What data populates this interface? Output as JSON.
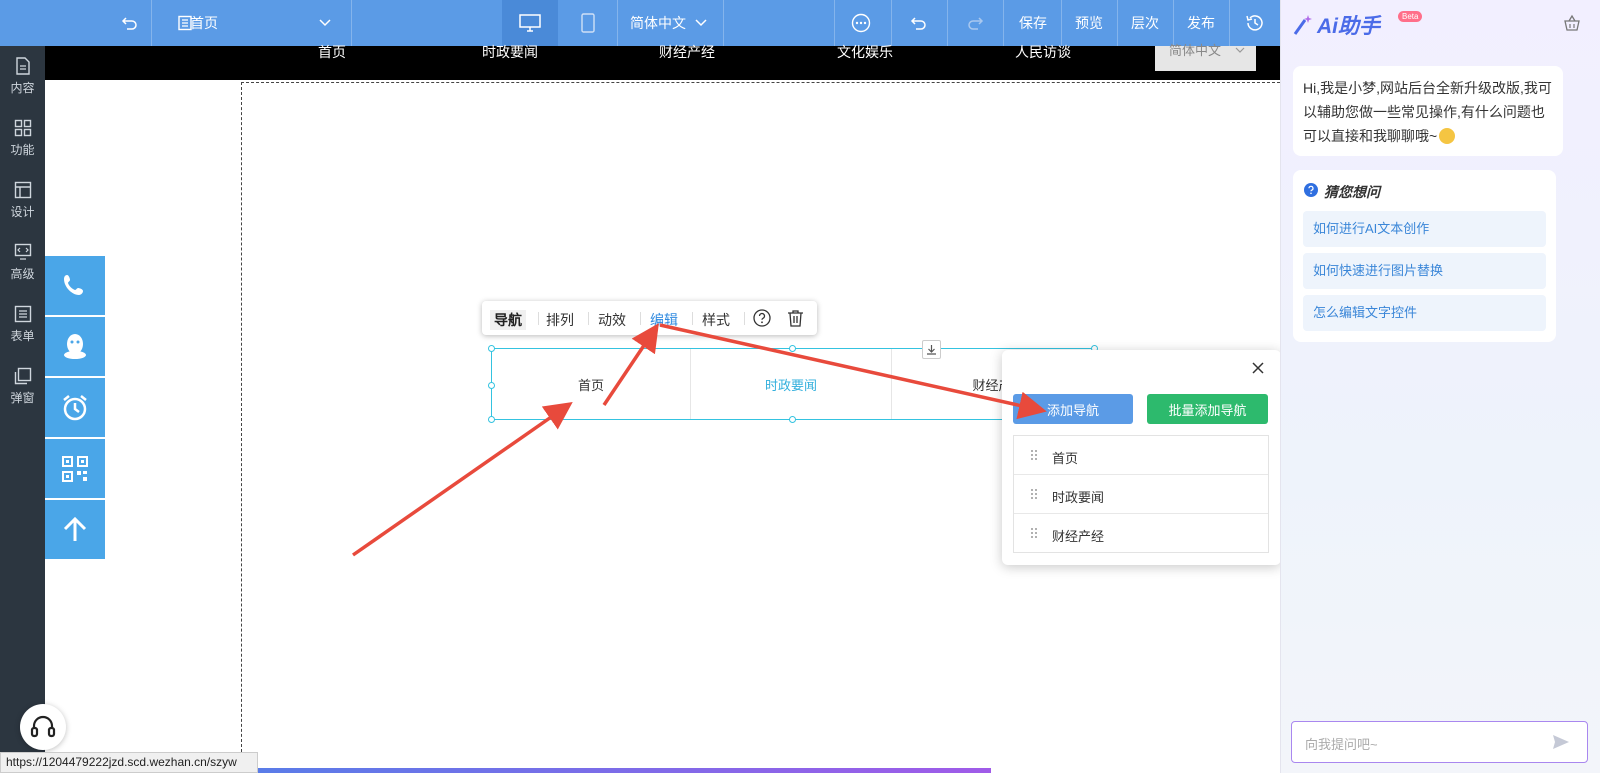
{
  "toolbar": {
    "page_selector": "首页",
    "language": "简体中文",
    "save": "保存",
    "preview": "预览",
    "layers": "层次",
    "publish": "发布",
    "colors": {
      "bg": "#5b9be6",
      "active": "#4a8ad8"
    }
  },
  "sidebar": {
    "items": [
      {
        "label": "内容",
        "icon": "file-icon"
      },
      {
        "label": "功能",
        "icon": "grid-icon"
      },
      {
        "label": "设计",
        "icon": "layout-icon"
      },
      {
        "label": "高级",
        "icon": "code-monitor-icon"
      },
      {
        "label": "表单",
        "icon": "form-icon"
      },
      {
        "label": "弹窗",
        "icon": "popup-icon"
      }
    ]
  },
  "site_nav": {
    "items": [
      "首页",
      "时政要闻",
      "财经产经",
      "文化娱乐",
      "人民访谈"
    ],
    "language": "简体中文"
  },
  "float_bar": {
    "icons": [
      "phone-icon",
      "qq-icon",
      "alarm-icon",
      "qrcode-icon",
      "arrow-up-icon"
    ],
    "color": "#4aa6e8"
  },
  "context_toolbar": {
    "items": [
      "导航",
      "排列",
      "动效",
      "编辑",
      "样式"
    ],
    "active": "导航",
    "highlight": "编辑"
  },
  "nav_widget": {
    "cells": [
      "首页",
      "时政要闻",
      "财经产"
    ]
  },
  "edit_panel": {
    "add_button": "添加导航",
    "batch_add_button": "批量添加导航",
    "items": [
      "首页",
      "时政要闻",
      "财经产经"
    ]
  },
  "ai": {
    "title": "Ai助手",
    "badge": "Beta",
    "greeting": "Hi,我是小梦,网站后台全新升级改版,我可以辅助您做一些常见操作,有什么问题也可以直接和我聊聊哦~",
    "guess_title": "猜您想问",
    "questions": [
      "如何进行AI文本创作",
      "如何快速进行图片替换",
      "怎么编辑文字控件"
    ],
    "input_placeholder": "向我提问吧~"
  },
  "status_url": "https://1204479222jzd.scd.wezhan.cn/szyw"
}
